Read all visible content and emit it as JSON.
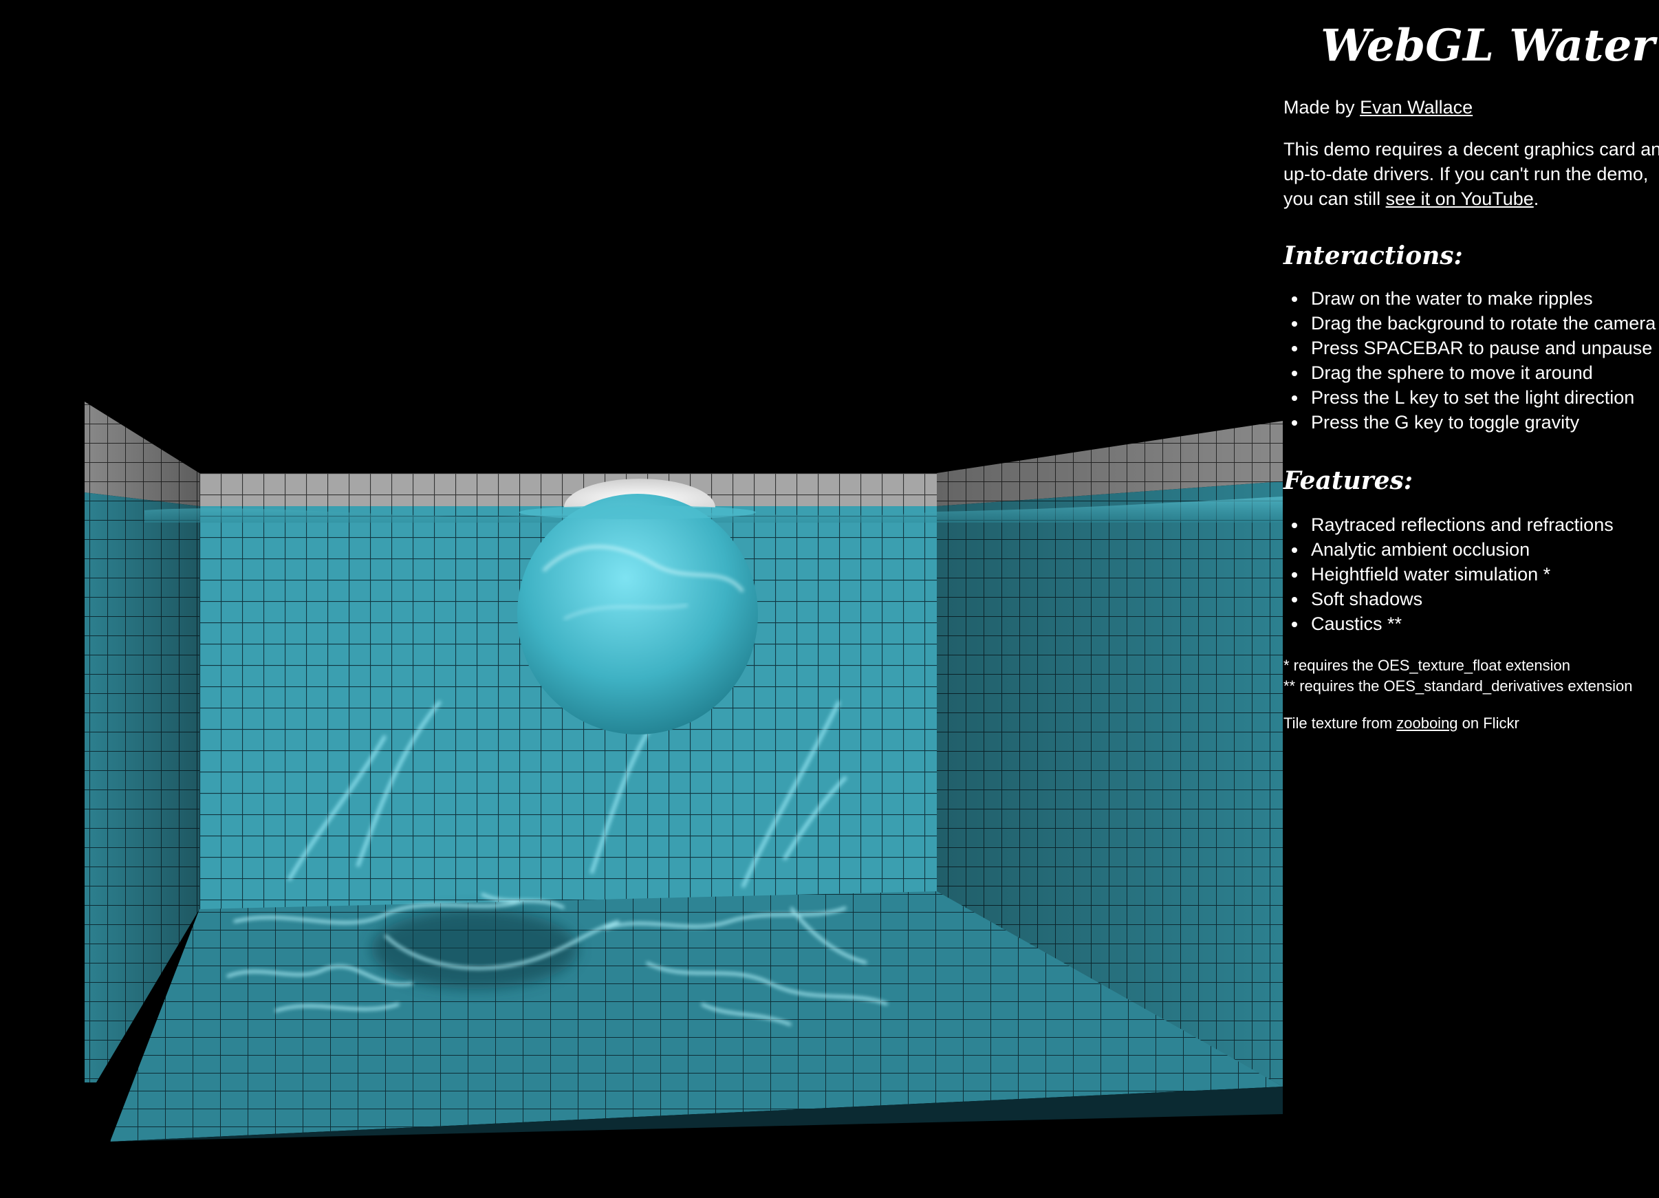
{
  "page": {
    "title": "WebGL Water",
    "made_by_prefix": "Made by ",
    "author_link": "Evan Wallace",
    "description_line1": "This demo requires a decent graphics card and",
    "description_line2": "up-to-date drivers. If you can't run the demo,",
    "description_line3_prefix": "you can still ",
    "youtube_link": "see it on YouTube",
    "description_line3_suffix": "."
  },
  "interactions": {
    "heading": "Interactions:",
    "items": [
      {
        "label": "Draw on the water to make ripples"
      },
      {
        "label": "Drag the background to rotate the camera"
      },
      {
        "label": "Press SPACEBAR to pause and unpause"
      },
      {
        "label": "Drag the sphere to move it around"
      },
      {
        "label": "Press the L key to set the light direction"
      },
      {
        "label": "Press the G key to toggle gravity"
      }
    ]
  },
  "features": {
    "heading": "Features:",
    "items": [
      {
        "label": "Raytraced reflections and refractions"
      },
      {
        "label": "Analytic ambient occlusion"
      },
      {
        "label": "Heightfield water simulation *"
      },
      {
        "label": "Soft shadows"
      },
      {
        "label": "Caustics **"
      }
    ]
  },
  "footnotes": {
    "note1": "* requires the OES_texture_float extension",
    "note2": "** requires the OES_standard_derivatives extension"
  },
  "credit": {
    "prefix": "Tile texture from ",
    "link": "zooboing",
    "suffix": " on Flickr"
  },
  "scene": {
    "icons": [
      "pool-scene",
      "sphere"
    ],
    "colors": {
      "background": "#000000",
      "water_tile": "#3aa3b4",
      "water_tile_dark": "#1d6f7f",
      "tile_grout": "#123a44",
      "dry_tile": "#9a9a9a",
      "sphere_top": "#f2f2f2",
      "caustic": "#9ff0ff"
    }
  }
}
